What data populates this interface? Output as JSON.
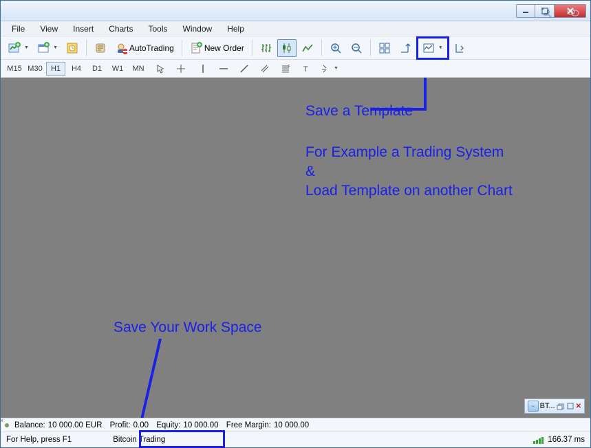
{
  "menu": [
    "File",
    "View",
    "Insert",
    "Charts",
    "Tools",
    "Window",
    "Help"
  ],
  "toolbar": {
    "autotrading": "AutoTrading",
    "neworder": "New Order"
  },
  "timeframes": [
    "M15",
    "M30",
    "H1",
    "H4",
    "D1",
    "W1",
    "MN"
  ],
  "timeframe_selected": "H1",
  "annotations": {
    "template": "Save a Template",
    "example1": "For Example a Trading System",
    "amp": "&",
    "example2": "Load Template on another Chart",
    "workspace": "Save Your Work Space"
  },
  "mini_tab": "BT...",
  "status": {
    "balance_label": "Balance:",
    "balance_value": "10 000.00 EUR",
    "profit_label": "Profit:",
    "profit_value": "0.00",
    "equity_label": "Equity:",
    "equity_value": "10 000.00",
    "freemargin_label": "Free Margin:",
    "freemargin_value": "10 000.00"
  },
  "bottom": {
    "help": "For Help, press F1",
    "workspace_name": "Bitcoin Trading",
    "ping": "166.37 ms"
  }
}
